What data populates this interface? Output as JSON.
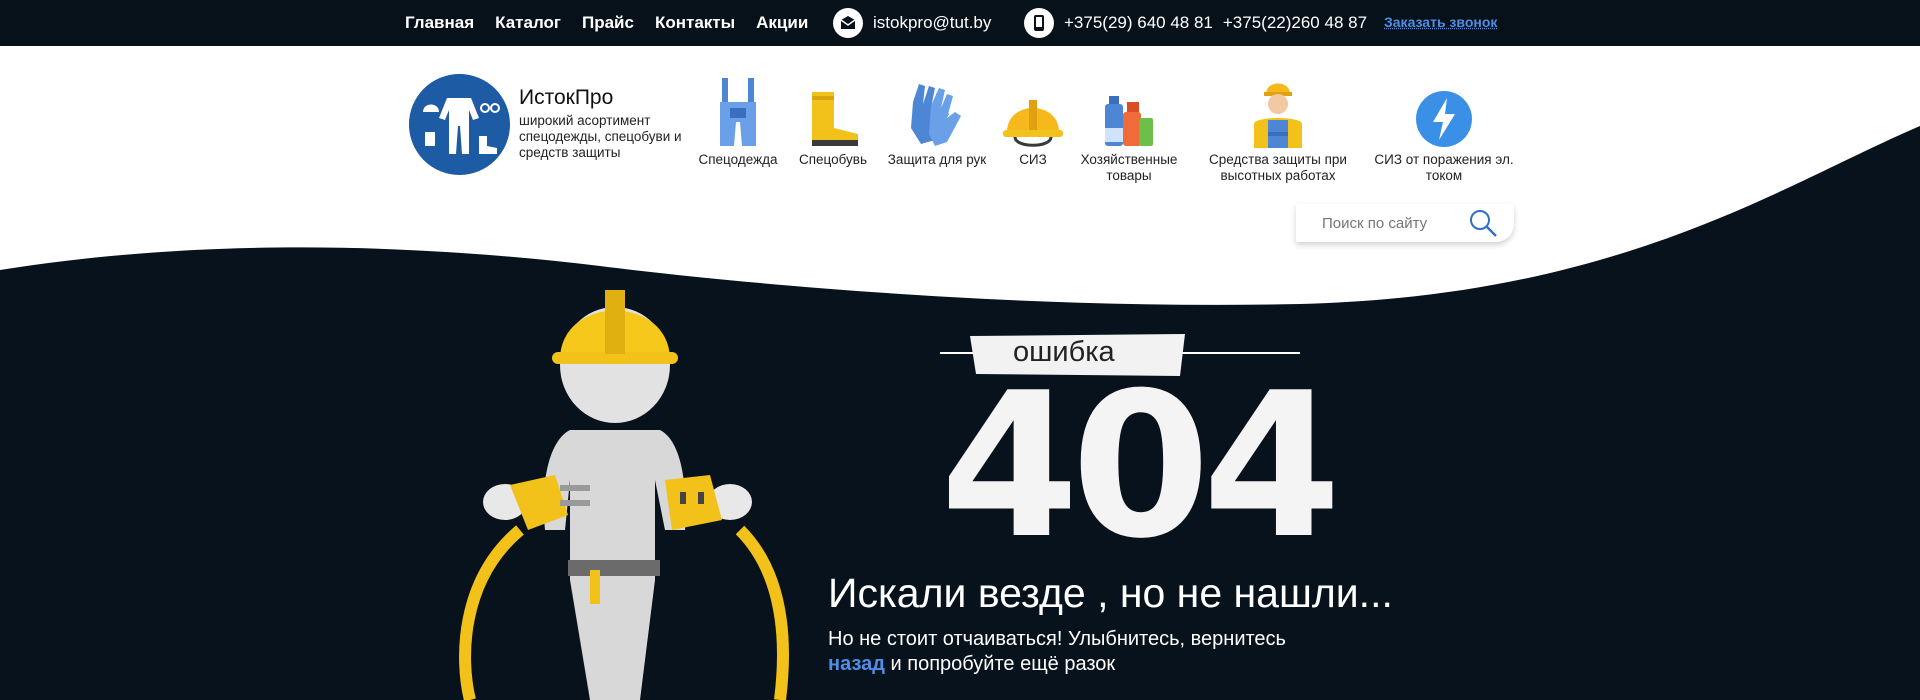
{
  "topnav": {
    "items": [
      "Главная",
      "Каталог",
      "Прайс",
      "Контакты",
      "Акции"
    ]
  },
  "contacts": {
    "email": "istokpro@tut.by",
    "phone1": "+375(29) 640 48 81",
    "phone2": "+375(22)260 48 87",
    "callback_label": "Заказать звонок"
  },
  "brand": {
    "name": "ИстокПро",
    "tagline": "широкий асортимент спецодежды, спецобуви и средств защиты"
  },
  "categories": [
    {
      "label": "Спецодежда",
      "icon": "overalls-icon"
    },
    {
      "label": "Спецобувь",
      "icon": "boots-icon"
    },
    {
      "label": "Защита для рук",
      "icon": "gloves-icon"
    },
    {
      "label": "СИЗ",
      "icon": "hardhat-icon"
    },
    {
      "label": "Хозяйственные товары",
      "icon": "household-icon"
    },
    {
      "label": "Средства защиты при высотных работах",
      "icon": "worker-icon"
    },
    {
      "label": "СИЗ от поражения эл. током",
      "icon": "lightning-icon"
    }
  ],
  "search": {
    "placeholder": "Поиск по сайту"
  },
  "error": {
    "label": "ошибка",
    "code": "404",
    "headline": "Искали везде , но не нашли...",
    "text_before": "Но не стоит отчаиваться! Улыбнитесь, вернитесь",
    "back_link": "назад",
    "text_after": " и попробуйте ещё разок"
  },
  "colors": {
    "dark": "#07121c",
    "accent": "#4f8ee8",
    "logo": "#1e5ba5"
  }
}
